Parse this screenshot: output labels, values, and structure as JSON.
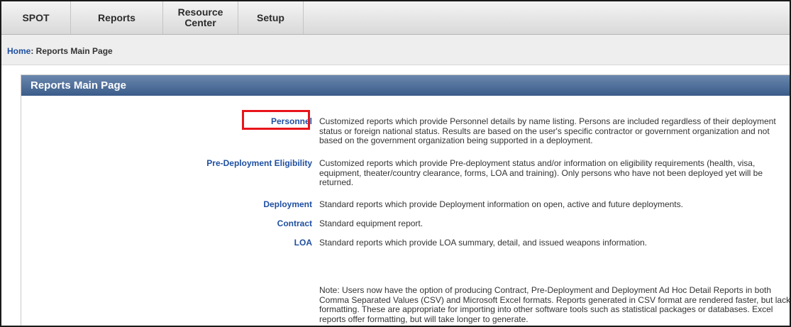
{
  "nav": {
    "items": [
      {
        "label": "SPOT"
      },
      {
        "label": "Reports"
      },
      {
        "label": "Resource\nCenter"
      },
      {
        "label": "Setup"
      }
    ]
  },
  "breadcrumb": {
    "home": "Home",
    "current": ": Reports Main Page"
  },
  "panel": {
    "title": "Reports Main Page"
  },
  "reports": [
    {
      "label": "Personnel",
      "description": "Customized reports which provide Personnel details by name listing. Persons are included regardless of their deployment status or foreign national status. Results are based on the user's specific contractor or government organization and not based on the government organization being supported in a deployment."
    },
    {
      "label": "Pre-Deployment Eligibility",
      "description": "Customized reports which provide Pre-deployment status and/or information on eligibility requirements (health, visa, equipment, theater/country clearance, forms, LOA and training). Only persons who have not been deployed yet will be returned."
    },
    {
      "label": "Deployment",
      "description": "Standard reports which provide Deployment information on open, active and future deployments."
    },
    {
      "label": "Contract",
      "description": "Standard equipment report."
    },
    {
      "label": "LOA",
      "description": "Standard reports which provide LOA summary, detail, and issued weapons information."
    }
  ],
  "note": "Note: Users now have the option of producing Contract, Pre-Deployment and Deployment Ad Hoc Detail Reports in both Comma Separated Values (CSV) and Microsoft Excel formats. Reports generated in CSV format are rendered faster, but lack formatting. These are appropriate for importing into other software tools such as statistical packages or databases. Excel reports offer formatting, but will take longer to generate.",
  "colors": {
    "nav_bg": "#e4e4e4",
    "header_blue": "#3b5c8a",
    "link_blue": "#1f4fa0",
    "highlight_red": "#e8141b"
  }
}
